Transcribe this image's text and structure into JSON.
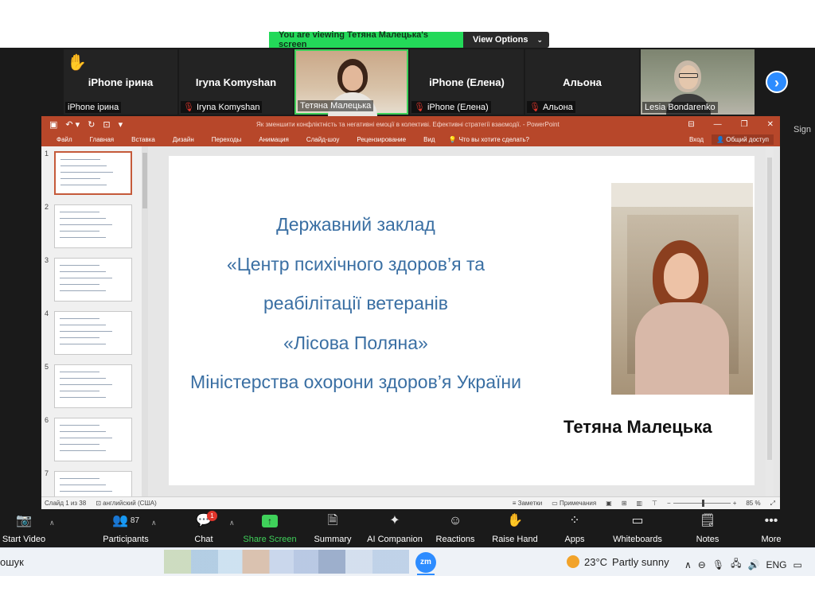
{
  "banner": {
    "viewing_text": "You are viewing Тетяна Малецька's screen",
    "view_options": "View Options"
  },
  "participants": [
    {
      "big": "iPhone ірина",
      "label": "iPhone ірина",
      "muted": false,
      "hand_raised": true
    },
    {
      "big": "Iryna Komyshan",
      "label": "Iryna Komyshan",
      "muted": true
    },
    {
      "big": "",
      "label": "Тетяна Малецька",
      "muted": false,
      "video": true,
      "active_speaker": true
    },
    {
      "big": "iPhone (Елена)",
      "label": "iPhone (Елена)",
      "muted": true
    },
    {
      "big": "Альона",
      "label": "Альона",
      "muted": true
    },
    {
      "big": "",
      "label": "Lesia Bondarenko",
      "muted": false,
      "video": true
    }
  ],
  "side_fragment": "Sign",
  "powerpoint": {
    "title": "Як зменшити конфліктність та негативні емоції в колективі. Ефективні стратегії взаємодії. - PowerPoint",
    "tabs": [
      "Файл",
      "Главная",
      "Вставка",
      "Дизайн",
      "Переходы",
      "Анимация",
      "Слайд-шоу",
      "Рецензирование",
      "Вид"
    ],
    "tell_me": "Что вы хотите сделать?",
    "login": "Вход",
    "share": "Общий доступ",
    "thumbnails": [
      "1",
      "2",
      "3",
      "4",
      "5",
      "6",
      "7"
    ],
    "slide": {
      "lines": [
        "Державний заклад",
        "«Центр психічного здоров’я та",
        "реабілітації ветеранів",
        "«Лісова Поляна»",
        "Міністерства охорони здоров’я України"
      ],
      "name": "Тетяна Малецька",
      "text_color": "#3a6fa3"
    },
    "status": {
      "slide_info": "Слайд 1 из 38",
      "language": "английский (США)",
      "notes": "Заметки",
      "comments": "Примечания",
      "zoom": "85 %"
    },
    "accent": "#b7472a"
  },
  "toolbar": {
    "items": [
      {
        "label": "Start Video",
        "icon": "video-off-icon"
      },
      {
        "label": "Participants",
        "icon": "participants-icon",
        "count": "87"
      },
      {
        "label": "Chat",
        "icon": "chat-icon",
        "badge": "1"
      },
      {
        "label": "Share Screen",
        "icon": "share-screen-icon"
      },
      {
        "label": "Summary",
        "icon": "summary-icon"
      },
      {
        "label": "AI Companion",
        "icon": "ai-companion-icon"
      },
      {
        "label": "Reactions",
        "icon": "reactions-icon"
      },
      {
        "label": "Raise Hand",
        "icon": "raise-hand-icon"
      },
      {
        "label": "Apps",
        "icon": "apps-icon"
      },
      {
        "label": "Whiteboards",
        "icon": "whiteboards-icon"
      },
      {
        "label": "Notes",
        "icon": "notes-icon"
      },
      {
        "label": "More",
        "icon": "more-icon"
      }
    ],
    "share_color": "#3fd15a"
  },
  "taskbar": {
    "search_fragment": "ошук",
    "zoom_app": "zm",
    "temperature": "23°C",
    "weather": "Partly sunny",
    "language": "ENG"
  }
}
